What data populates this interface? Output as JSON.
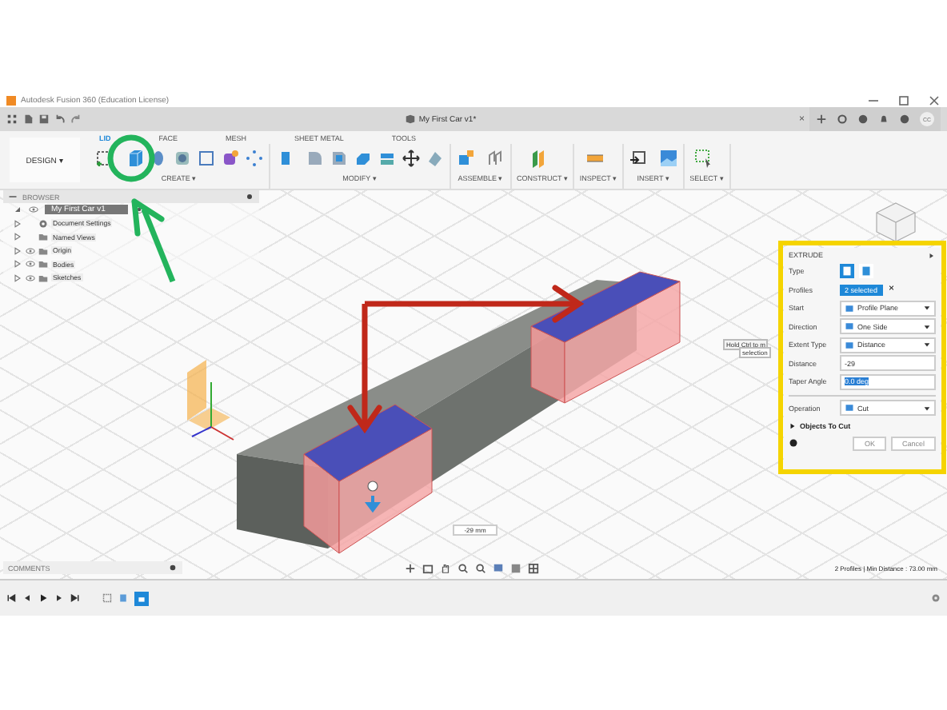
{
  "window": {
    "title": "Autodesk Fusion 360 (Education License)"
  },
  "document_tab": {
    "title": "My First Car v1*",
    "close": "×"
  },
  "user": {
    "initials": "CC"
  },
  "workspace_button": {
    "label": "DESIGN ▾"
  },
  "toolbar_tabs": [
    {
      "label": "LID",
      "selected": true
    },
    {
      "label": "FACE",
      "selected": false
    },
    {
      "label": "MESH",
      "selected": false
    },
    {
      "label": "SHEET METAL",
      "selected": false
    },
    {
      "label": "TOOLS",
      "selected": false
    }
  ],
  "toolbar_groups": [
    {
      "label": "CREATE ▾",
      "kind": "create"
    },
    {
      "label": "MODIFY ▾",
      "kind": "modify"
    },
    {
      "label": "ASSEMBLE ▾",
      "kind": "assemble"
    },
    {
      "label": "CONSTRUCT ▾",
      "kind": "construct"
    },
    {
      "label": "INSPECT ▾",
      "kind": "inspect"
    },
    {
      "label": "INSERT ▾",
      "kind": "insert"
    },
    {
      "label": "SELECT ▾",
      "kind": "select"
    }
  ],
  "browser": {
    "title": "BROWSER",
    "root": {
      "label": "My First Car v1",
      "selected": true,
      "children": [
        {
          "label": "Document Settings",
          "kind": "settings",
          "visible": false,
          "selected": false
        },
        {
          "label": "Named Views",
          "kind": "folder",
          "visible": false,
          "selected": false
        },
        {
          "label": "Origin",
          "kind": "folder",
          "visible": true,
          "selected": false
        },
        {
          "label": "Bodies",
          "kind": "folder",
          "visible": true,
          "selected": false
        },
        {
          "label": "Sketches",
          "kind": "folder",
          "visible": true,
          "selected": false
        }
      ]
    }
  },
  "extrude": {
    "title": "EXTRUDE",
    "type_options": [
      {
        "selected": true
      },
      {
        "selected": false
      }
    ],
    "rows": [
      {
        "label": "Type",
        "kind": "type"
      },
      {
        "label": "Profiles",
        "kind": "selection",
        "value": "2 selected",
        "clear": "×"
      },
      {
        "label": "Start",
        "kind": "dropdown",
        "value": "Profile Plane"
      },
      {
        "label": "Direction",
        "kind": "dropdown",
        "value": "One Side"
      },
      {
        "label": "Extent Type",
        "kind": "dropdown",
        "value": "Distance"
      },
      {
        "label": "Distance",
        "kind": "input",
        "value": "-29",
        "highlighted": false
      },
      {
        "label": "Taper Angle",
        "kind": "input",
        "value": "0.0 deg",
        "highlighted": true
      },
      {
        "label": "Operation",
        "kind": "dropdown",
        "value": "Cut"
      }
    ],
    "section": "Objects To Cut",
    "buttons": [
      "OK",
      "Cancel"
    ]
  },
  "tooltip": {
    "text": "Hold Ctrl to m",
    "note": "selection"
  },
  "dimension_input": {
    "value": "-29 mm"
  },
  "comments": {
    "title": "COMMENTS"
  },
  "status": "2 Profiles | Min Distance : 73.00 mm"
}
